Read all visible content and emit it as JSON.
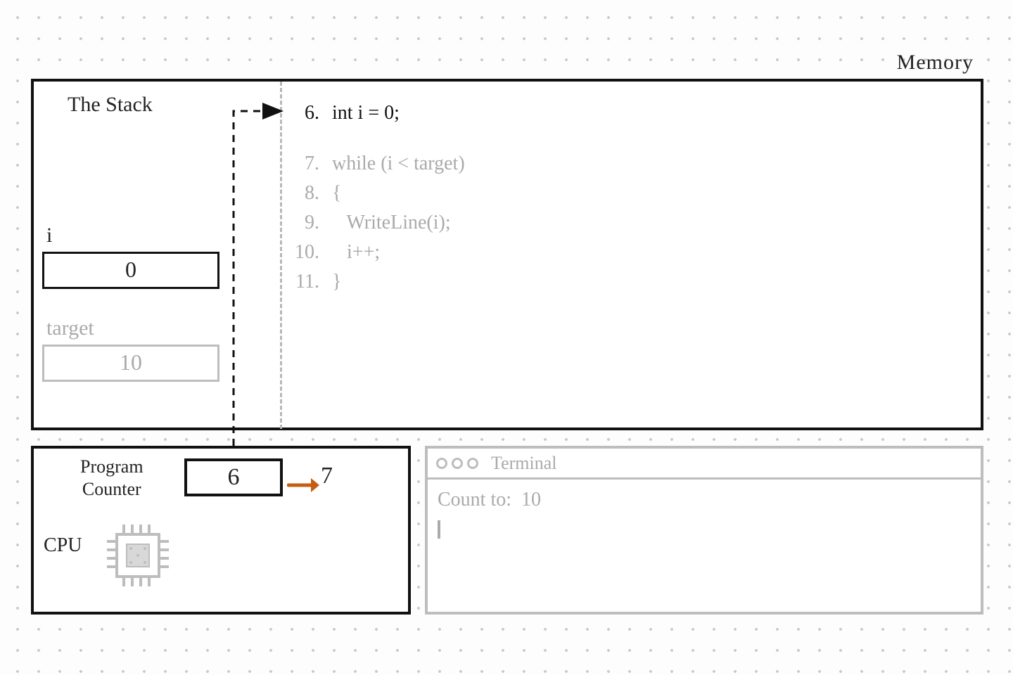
{
  "labels": {
    "memory": "Memory",
    "stack": "The Stack",
    "cpu": "CPU",
    "program_counter_line1": "Program",
    "program_counter_line2": "Counter",
    "terminal": "Terminal"
  },
  "stack": {
    "vars": [
      {
        "name": "i",
        "value": "0",
        "faded": false
      },
      {
        "name": "target",
        "value": "10",
        "faded": true
      }
    ]
  },
  "code": {
    "current_line": 6,
    "lines": [
      {
        "n": "6.",
        "text": "int i = 0;",
        "current": true
      },
      {
        "gap": true
      },
      {
        "n": "7.",
        "text": "while (i < target)"
      },
      {
        "n": "8.",
        "text": "{"
      },
      {
        "n": "9.",
        "text": "   WriteLine(i);"
      },
      {
        "n": "10.",
        "text": "   i++;"
      },
      {
        "n": "11.",
        "text": "}"
      }
    ]
  },
  "cpu": {
    "pc_value": "6",
    "pc_next": "7"
  },
  "terminal": {
    "prompt_label": "Count to:",
    "prompt_value": "10",
    "output_lines": []
  },
  "colors": {
    "ink": "#111111",
    "faded": "#aaaaaa",
    "accent": "#c65d13"
  }
}
